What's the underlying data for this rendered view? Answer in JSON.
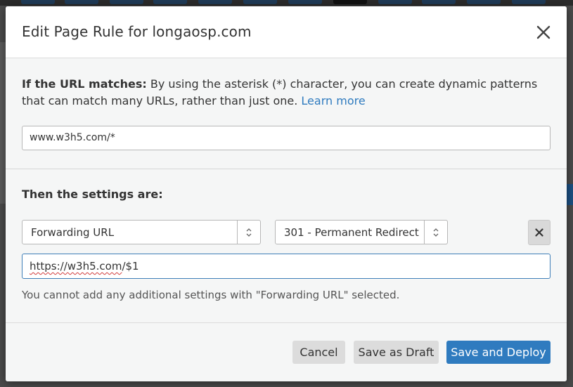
{
  "modal": {
    "title": "Edit Page Rule for longaosp.com",
    "close_icon": "close-icon"
  },
  "match_section": {
    "label": "If the URL matches:",
    "description": "By using the asterisk (*) character, you can create dynamic patterns that can match many URLs, rather than just one.",
    "learn_more": "Learn more",
    "url_value": "www.w3h5.com/*"
  },
  "settings_section": {
    "heading": "Then the settings are:",
    "setting_type": "Forwarding URL",
    "status_code": "301 - Permanent Redirect",
    "destination_prefix": "https://w3h5.com",
    "destination_suffix": "/$1",
    "notice": "You cannot add any additional settings with \"Forwarding URL\" selected."
  },
  "footer": {
    "cancel_label": "Cancel",
    "draft_label": "Save as Draft",
    "deploy_label": "Save and Deploy"
  },
  "colors": {
    "accent": "#2f7bbf",
    "modal_bg": "#f5f6f6",
    "header_bg": "#ffffff"
  }
}
